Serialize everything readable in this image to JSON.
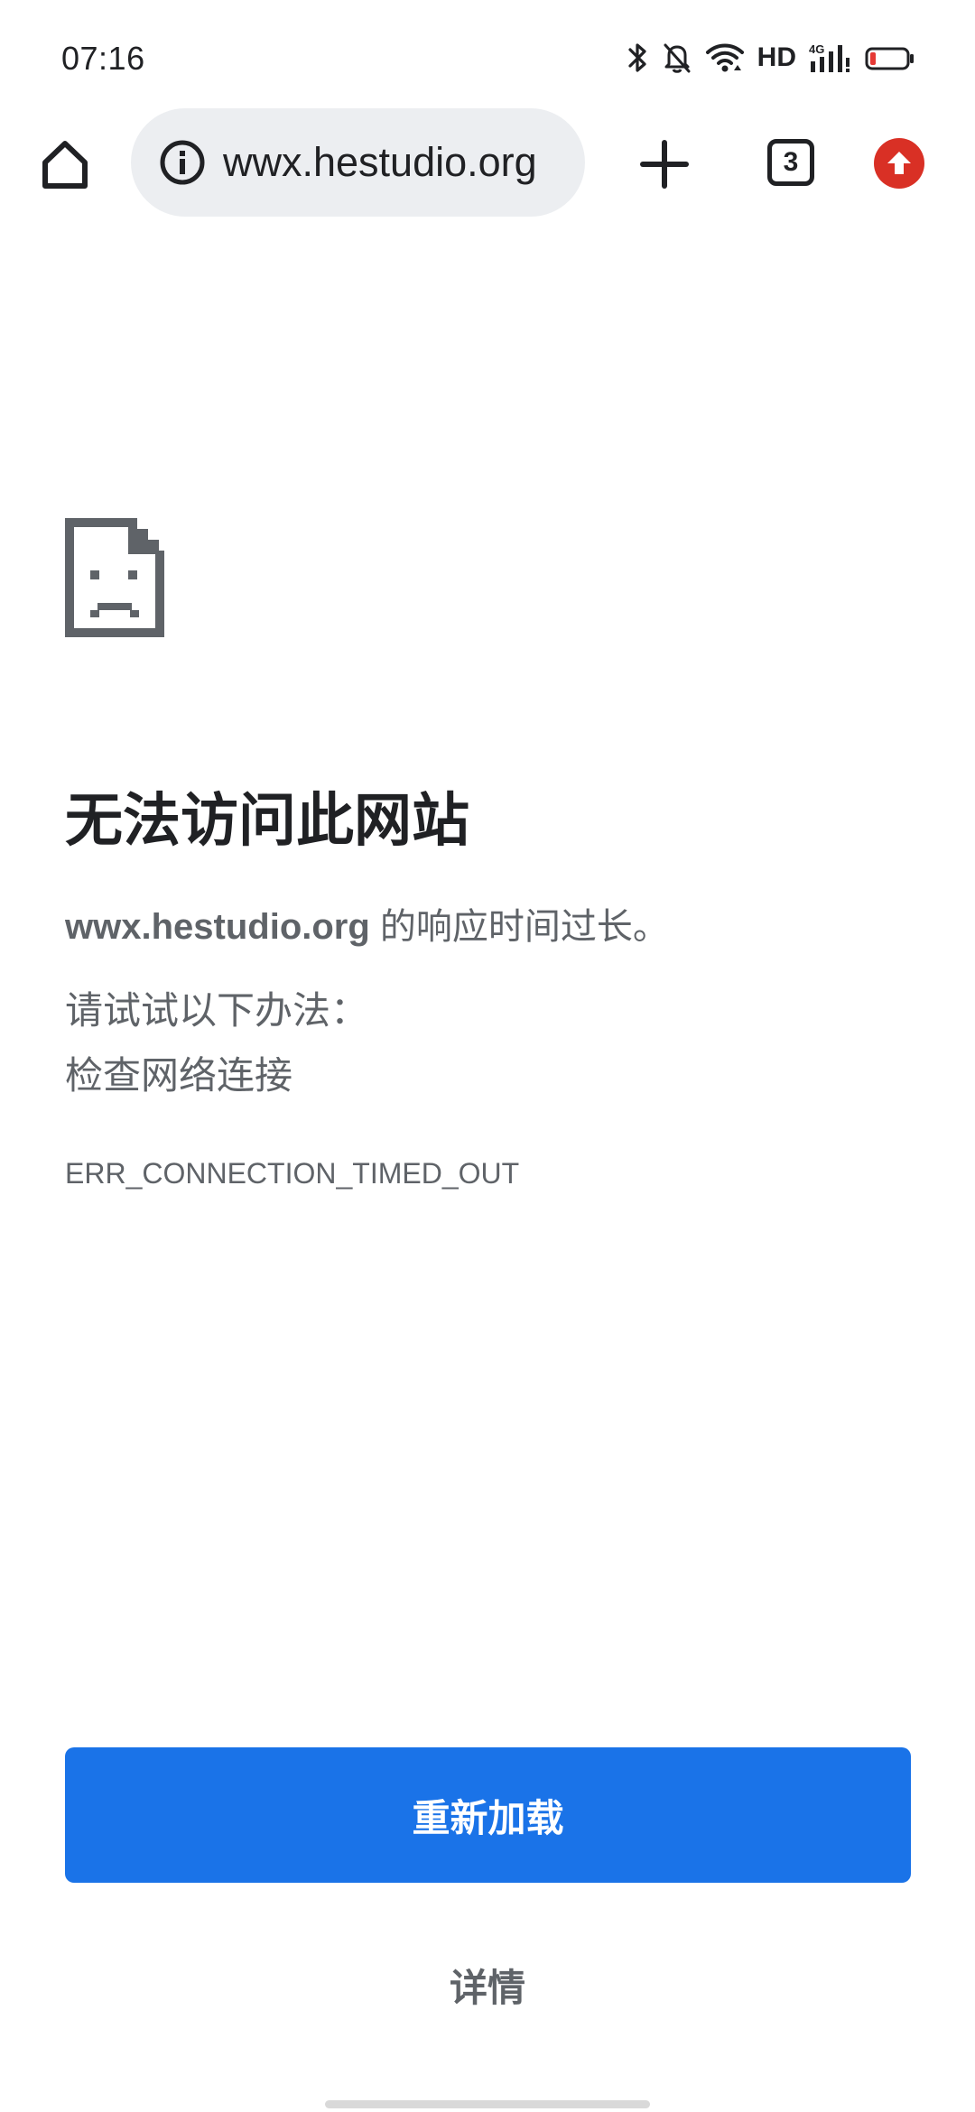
{
  "status_bar": {
    "time": "07:16",
    "network_label": "HD",
    "icons": [
      "bluetooth-icon",
      "bell-muted-icon",
      "wifi-icon",
      "signal-4g-icon",
      "battery-low-icon"
    ],
    "battery_color": "#e53935"
  },
  "toolbar": {
    "url": "wwx.hestudio.org",
    "tab_count": "3",
    "icons": [
      "home-icon",
      "info-icon",
      "plus-icon",
      "tab-switcher-icon",
      "update-arrow-icon"
    ],
    "update_color": "#d93025"
  },
  "error": {
    "icon": "sad-page-icon",
    "title": "无法访问此网站",
    "host": "wwx.hestudio.org",
    "description_suffix": " 的响应时间过长。",
    "suggestions_heading": "请试试以下办法：",
    "suggestions": [
      "检查网络连接"
    ],
    "code": "ERR_CONNECTION_TIMED_OUT"
  },
  "actions": {
    "reload_label": "重新加载",
    "details_label": "详情",
    "accent_color": "#1a73e8"
  }
}
